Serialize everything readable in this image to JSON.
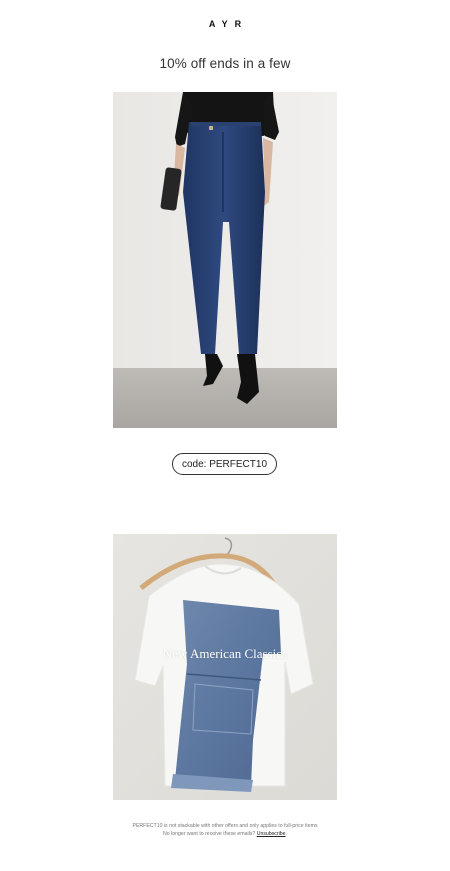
{
  "brand": {
    "logo_text": "AYR"
  },
  "headline": "10% off ends in a few",
  "promo_code": {
    "label": "code: PERFECT10"
  },
  "collection": {
    "title": "New American Classics"
  },
  "footer": {
    "disclaimer": "PERFECT10 is not stackable with other offers and only applies to full-price items",
    "unsubscribe_prompt": "No longer want to receive these emails?",
    "unsubscribe_link": "Unsubscribe",
    "unsubscribe_suffix": "."
  }
}
